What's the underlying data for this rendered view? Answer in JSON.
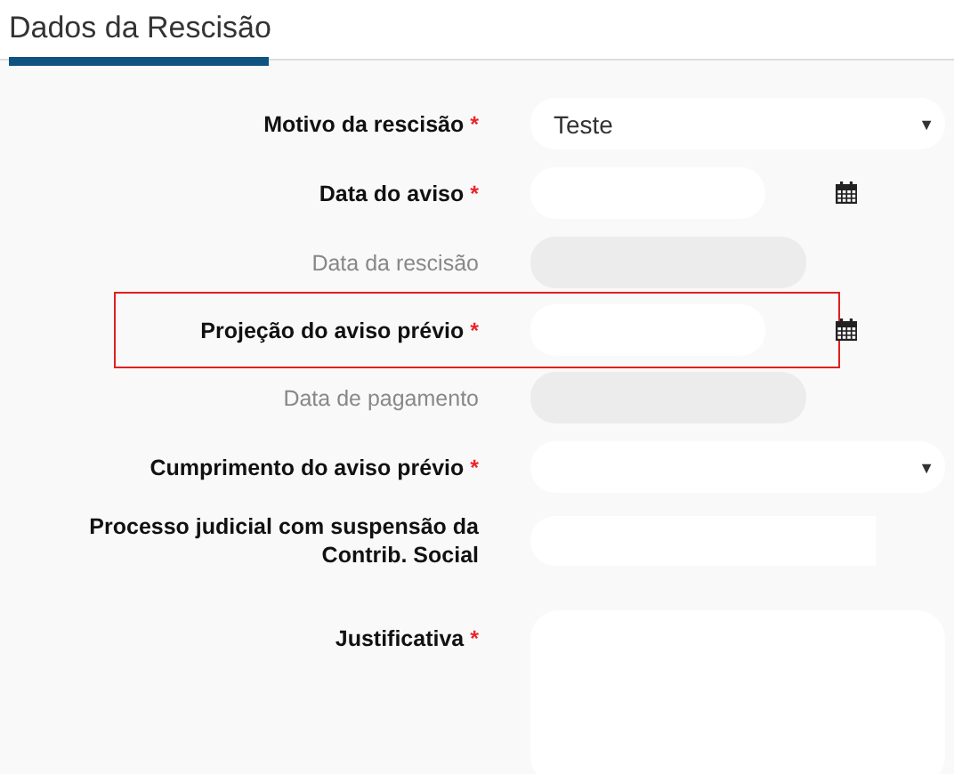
{
  "section": {
    "title": "Dados da Rescisão"
  },
  "fields": [
    {
      "label": "Motivo da rescisão",
      "kind": "select",
      "required_mark": "*",
      "disabled": false,
      "highlighted": false,
      "value": "Teste",
      "caret": "▼"
    },
    {
      "label": "Data do aviso",
      "kind": "date",
      "required_mark": "*",
      "disabled": false,
      "highlighted": false
    },
    {
      "label": "Data da rescisão",
      "kind": "text",
      "disabled": true,
      "highlighted": false
    },
    {
      "label": "Projeção do aviso prévio",
      "kind": "date",
      "required_mark": "*",
      "disabled": false,
      "highlighted": true
    },
    {
      "label": "Data de pagamento",
      "kind": "text",
      "disabled": true,
      "highlighted": false
    },
    {
      "label": "Cumprimento do aviso prévio",
      "kind": "select",
      "required_mark": "*",
      "disabled": false,
      "highlighted": false,
      "caret": "▼"
    },
    {
      "label": "Processo judicial com suspensão da Contrib. Social",
      "kind": "text",
      "disabled": false,
      "highlighted": false
    },
    {
      "label": "Justificativa",
      "kind": "textarea",
      "required_mark": "*",
      "disabled": false,
      "highlighted": false
    }
  ]
}
